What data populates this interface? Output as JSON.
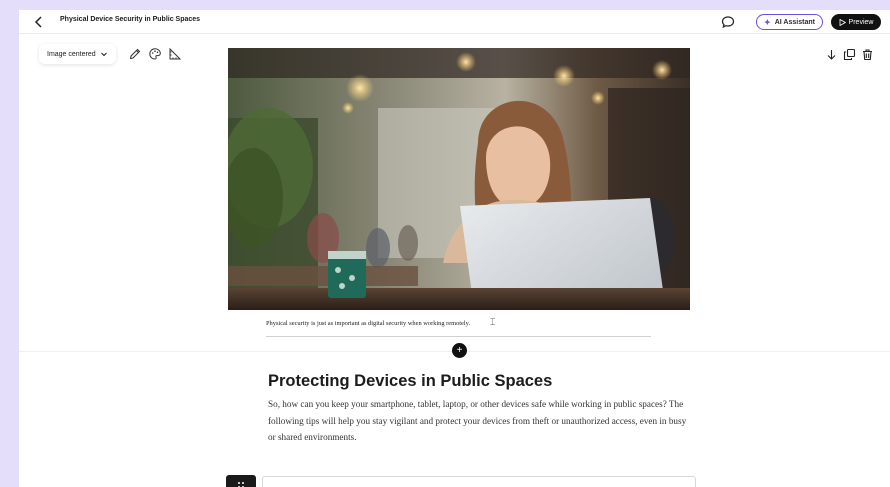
{
  "topbar": {
    "back_icon": "chevron-left-icon",
    "title": "Physical Device Security in Public Spaces",
    "comment_icon": "speech-bubble-icon",
    "ai_assistant_label": "AI Assistant",
    "ai_icon": "sparkle-icon",
    "preview_label": "Preview",
    "preview_icon": "play-icon",
    "accent_color": "#6b4fe0"
  },
  "image_toolbar": {
    "alignment_value": "Image centered",
    "dropdown_icon": "chevron-down-icon",
    "tools": [
      "pencil-icon",
      "palette-icon",
      "ruler-triangle-icon"
    ]
  },
  "block_tools": [
    "arrow-down-icon",
    "duplicate-icon",
    "trash-icon"
  ],
  "image": {
    "caption": "Physical security is just as important as digital security when working remotely."
  },
  "add_block_label": "+",
  "section": {
    "heading": "Protecting Devices in Public Spaces",
    "body": "So, how can you keep your smartphone, tablet, laptop, or other devices safe while working in public spaces? The following tips will help you stay vigilant and protect your devices from theft or unauthorized access, even in busy or shared environments."
  }
}
